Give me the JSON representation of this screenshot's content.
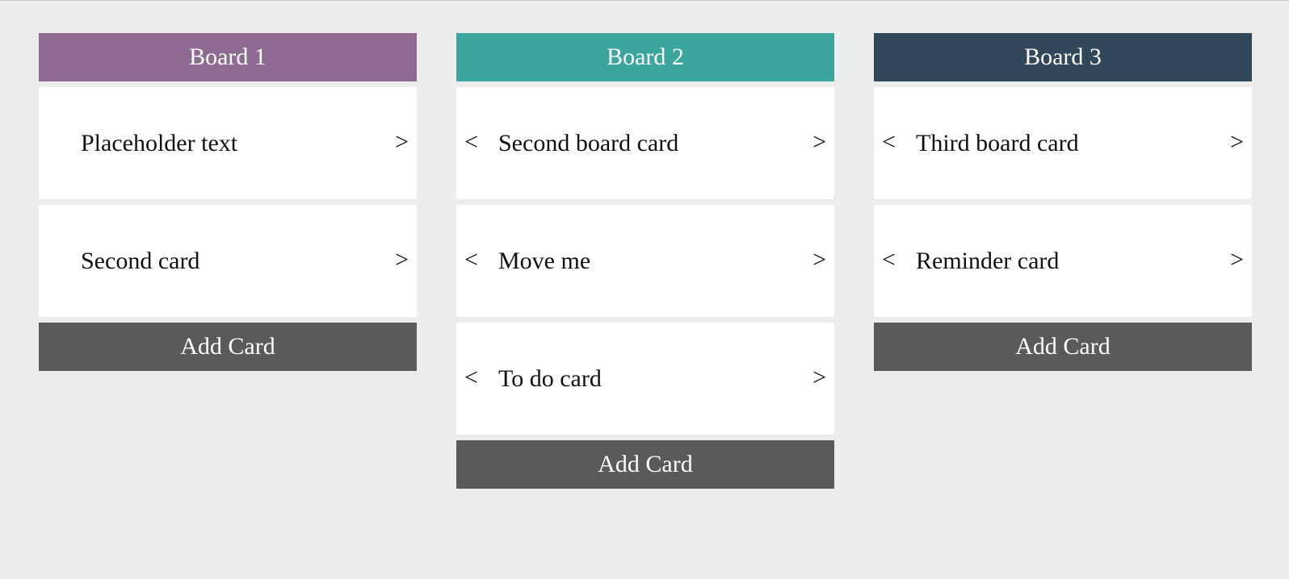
{
  "boards": [
    {
      "title": "Board 1",
      "color": "#8f6b93",
      "add_label": "Add Card",
      "cards": [
        {
          "text": "Placeholder text",
          "left": "",
          "right": ">"
        },
        {
          "text": "Second card",
          "left": "",
          "right": ">"
        }
      ]
    },
    {
      "title": "Board 2",
      "color": "#3ba59e",
      "add_label": "Add Card",
      "cards": [
        {
          "text": "Second board card",
          "left": "<",
          "right": ">"
        },
        {
          "text": "Move me",
          "left": "<",
          "right": ">"
        },
        {
          "text": "To do card",
          "left": "<",
          "right": ">"
        }
      ]
    },
    {
      "title": "Board 3",
      "color": "#33475b",
      "add_label": "Add Card",
      "cards": [
        {
          "text": "Third board card",
          "left": "<",
          "right": ">"
        },
        {
          "text": "Reminder card",
          "left": "<",
          "right": ">"
        }
      ]
    }
  ]
}
